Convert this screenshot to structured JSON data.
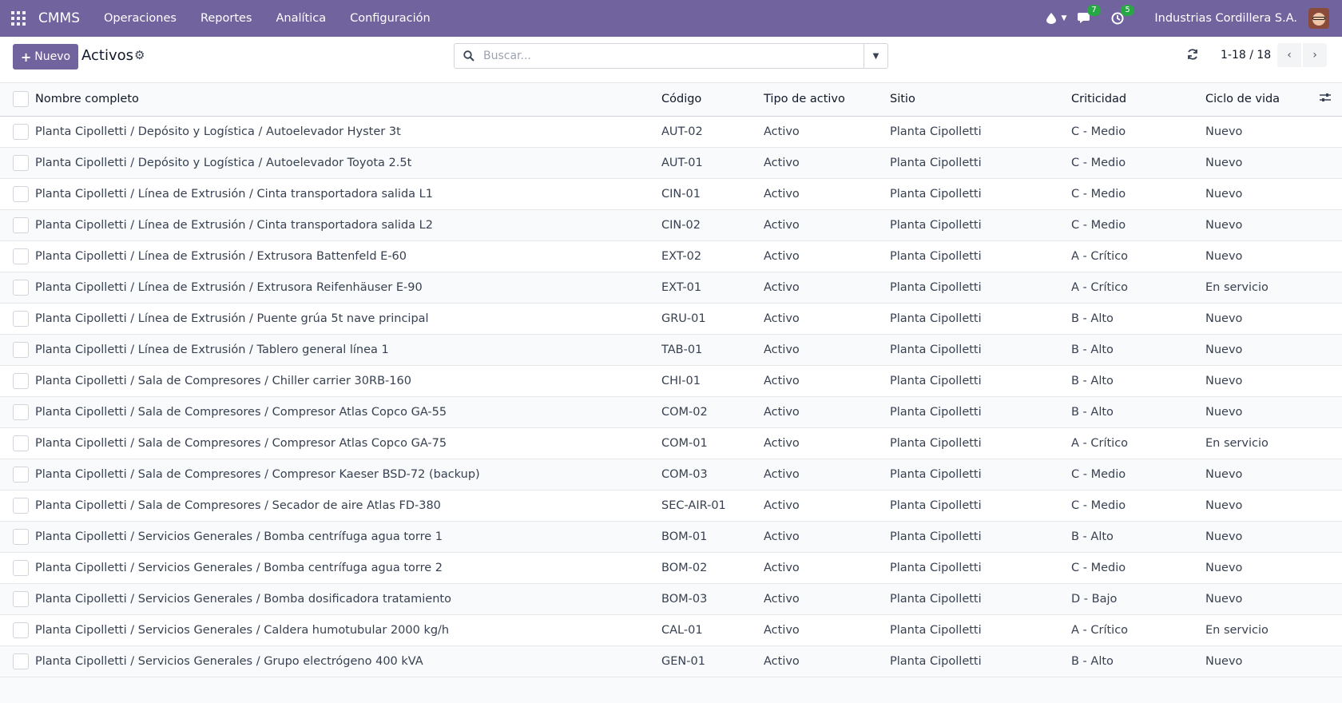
{
  "navbar": {
    "brand": "CMMS",
    "menu": [
      "Operaciones",
      "Reportes",
      "Analítica",
      "Configuración"
    ],
    "messages_count": "7",
    "activities_count": "5",
    "company": "Industrias Cordillera S.A."
  },
  "control": {
    "new_label": "Nuevo",
    "title": "Activos",
    "search_placeholder": "Buscar...",
    "pager": "1-18 / 18"
  },
  "table": {
    "columns": [
      "Nombre completo",
      "Código",
      "Tipo de activo",
      "Sitio",
      "Criticidad",
      "Ciclo de vida"
    ],
    "rows": [
      {
        "name": "Planta Cipolletti / Depósito y Logística / Autoelevador Hyster 3t",
        "code": "AUT-02",
        "type": "Activo",
        "site": "Planta Cipolletti",
        "crit": "C - Medio",
        "life": "Nuevo"
      },
      {
        "name": "Planta Cipolletti / Depósito y Logística / Autoelevador Toyota 2.5t",
        "code": "AUT-01",
        "type": "Activo",
        "site": "Planta Cipolletti",
        "crit": "C - Medio",
        "life": "Nuevo"
      },
      {
        "name": "Planta Cipolletti / Línea de Extrusión / Cinta transportadora salida L1",
        "code": "CIN-01",
        "type": "Activo",
        "site": "Planta Cipolletti",
        "crit": "C - Medio",
        "life": "Nuevo"
      },
      {
        "name": "Planta Cipolletti / Línea de Extrusión / Cinta transportadora salida L2",
        "code": "CIN-02",
        "type": "Activo",
        "site": "Planta Cipolletti",
        "crit": "C - Medio",
        "life": "Nuevo"
      },
      {
        "name": "Planta Cipolletti / Línea de Extrusión / Extrusora Battenfeld E-60",
        "code": "EXT-02",
        "type": "Activo",
        "site": "Planta Cipolletti",
        "crit": "A - Crítico",
        "life": "Nuevo"
      },
      {
        "name": "Planta Cipolletti / Línea de Extrusión / Extrusora Reifenhäuser E-90",
        "code": "EXT-01",
        "type": "Activo",
        "site": "Planta Cipolletti",
        "crit": "A - Crítico",
        "life": "En servicio"
      },
      {
        "name": "Planta Cipolletti / Línea de Extrusión / Puente grúa 5t nave principal",
        "code": "GRU-01",
        "type": "Activo",
        "site": "Planta Cipolletti",
        "crit": "B - Alto",
        "life": "Nuevo"
      },
      {
        "name": "Planta Cipolletti / Línea de Extrusión / Tablero general línea 1",
        "code": "TAB-01",
        "type": "Activo",
        "site": "Planta Cipolletti",
        "crit": "B - Alto",
        "life": "Nuevo"
      },
      {
        "name": "Planta Cipolletti / Sala de Compresores / Chiller carrier 30RB-160",
        "code": "CHI-01",
        "type": "Activo",
        "site": "Planta Cipolletti",
        "crit": "B - Alto",
        "life": "Nuevo"
      },
      {
        "name": "Planta Cipolletti / Sala de Compresores / Compresor Atlas Copco GA-55",
        "code": "COM-02",
        "type": "Activo",
        "site": "Planta Cipolletti",
        "crit": "B - Alto",
        "life": "Nuevo"
      },
      {
        "name": "Planta Cipolletti / Sala de Compresores / Compresor Atlas Copco GA-75",
        "code": "COM-01",
        "type": "Activo",
        "site": "Planta Cipolletti",
        "crit": "A - Crítico",
        "life": "En servicio"
      },
      {
        "name": "Planta Cipolletti / Sala de Compresores / Compresor Kaeser BSD-72 (backup)",
        "code": "COM-03",
        "type": "Activo",
        "site": "Planta Cipolletti",
        "crit": "C - Medio",
        "life": "Nuevo"
      },
      {
        "name": "Planta Cipolletti / Sala de Compresores / Secador de aire Atlas FD-380",
        "code": "SEC-AIR-01",
        "type": "Activo",
        "site": "Planta Cipolletti",
        "crit": "C - Medio",
        "life": "Nuevo"
      },
      {
        "name": "Planta Cipolletti / Servicios Generales / Bomba centrífuga agua torre 1",
        "code": "BOM-01",
        "type": "Activo",
        "site": "Planta Cipolletti",
        "crit": "B - Alto",
        "life": "Nuevo"
      },
      {
        "name": "Planta Cipolletti / Servicios Generales / Bomba centrífuga agua torre 2",
        "code": "BOM-02",
        "type": "Activo",
        "site": "Planta Cipolletti",
        "crit": "C - Medio",
        "life": "Nuevo"
      },
      {
        "name": "Planta Cipolletti / Servicios Generales / Bomba dosificadora tratamiento",
        "code": "BOM-03",
        "type": "Activo",
        "site": "Planta Cipolletti",
        "crit": "D - Bajo",
        "life": "Nuevo"
      },
      {
        "name": "Planta Cipolletti / Servicios Generales / Caldera humotubular 2000 kg/h",
        "code": "CAL-01",
        "type": "Activo",
        "site": "Planta Cipolletti",
        "crit": "A - Crítico",
        "life": "En servicio"
      },
      {
        "name": "Planta Cipolletti / Servicios Generales / Grupo electrógeno 400 kVA",
        "code": "GEN-01",
        "type": "Activo",
        "site": "Planta Cipolletti",
        "crit": "B - Alto",
        "life": "Nuevo"
      }
    ]
  }
}
